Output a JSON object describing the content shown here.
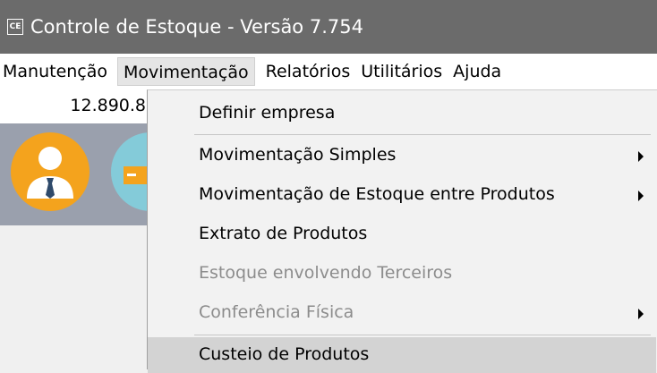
{
  "window": {
    "icon_text": "CE",
    "title": "Controle de Estoque - Versão 7.754"
  },
  "menubar": {
    "items": [
      {
        "label": "Manutenção"
      },
      {
        "label": "Movimentação"
      },
      {
        "label": "Relatórios"
      },
      {
        "label": "Utilitários"
      },
      {
        "label": "Ajuda"
      }
    ]
  },
  "background": {
    "value": "12.890.8"
  },
  "dropdown": {
    "items": [
      {
        "label": "Definir empresa"
      },
      {
        "label": "Movimentação Simples"
      },
      {
        "label": "Movimentação de Estoque entre Produtos"
      },
      {
        "label": "Extrato de Produtos"
      },
      {
        "label": "Estoque envolvendo Terceiros"
      },
      {
        "label": "Conferência Física"
      },
      {
        "label": "Custeio de Produtos"
      }
    ]
  }
}
